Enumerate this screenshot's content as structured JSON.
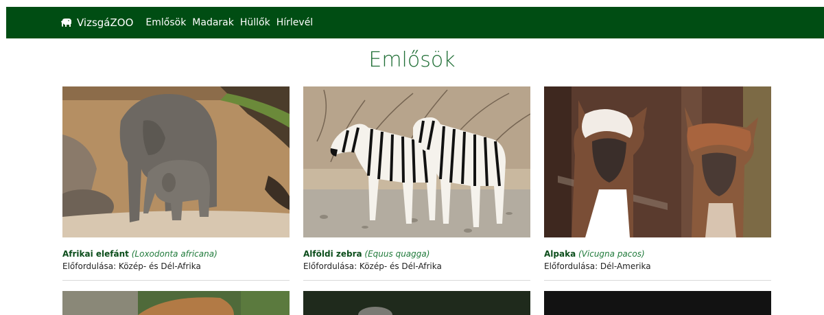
{
  "nav": {
    "brand": "VizsgáZOO",
    "brand_icon": "elephant-icon",
    "links": [
      "Emlősök",
      "Madarak",
      "Hüllők",
      "Hírlevél"
    ]
  },
  "page_title": "Emlősök",
  "cards": [
    {
      "name": "Afrikai elefánt",
      "latin": "(Loxodonta africana)",
      "region": "Előfordulása: Közép- és Dél-Afrika"
    },
    {
      "name": "Alföldi zebra",
      "latin": "(Equus quagga)",
      "region": "Előfordulása: Közép- és Dél-Afrika"
    },
    {
      "name": "Alpaka",
      "latin": "(Vicugna pacos)",
      "region": "Előfordulása: Dél-Amerika"
    }
  ],
  "colors": {
    "navbar": "#004d13",
    "title": "#1f6e35",
    "name": "#0b4d1b"
  }
}
